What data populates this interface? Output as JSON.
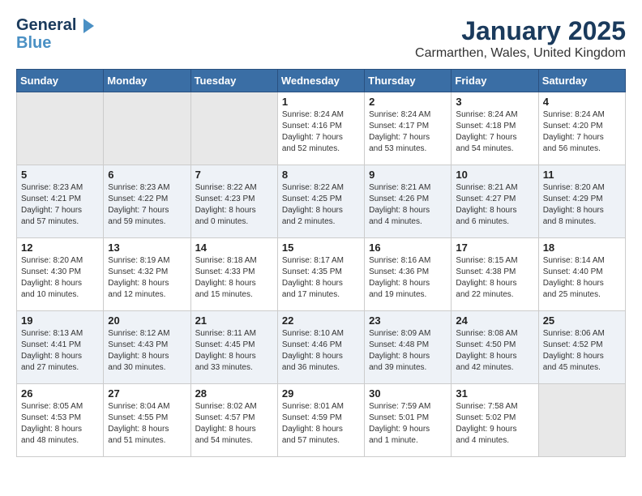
{
  "header": {
    "logo_line1": "General",
    "logo_line2": "Blue",
    "month": "January 2025",
    "location": "Carmarthen, Wales, United Kingdom"
  },
  "weekdays": [
    "Sunday",
    "Monday",
    "Tuesday",
    "Wednesday",
    "Thursday",
    "Friday",
    "Saturday"
  ],
  "weeks": [
    [
      {
        "day": "",
        "info": ""
      },
      {
        "day": "",
        "info": ""
      },
      {
        "day": "",
        "info": ""
      },
      {
        "day": "1",
        "info": "Sunrise: 8:24 AM\nSunset: 4:16 PM\nDaylight: 7 hours\nand 52 minutes."
      },
      {
        "day": "2",
        "info": "Sunrise: 8:24 AM\nSunset: 4:17 PM\nDaylight: 7 hours\nand 53 minutes."
      },
      {
        "day": "3",
        "info": "Sunrise: 8:24 AM\nSunset: 4:18 PM\nDaylight: 7 hours\nand 54 minutes."
      },
      {
        "day": "4",
        "info": "Sunrise: 8:24 AM\nSunset: 4:20 PM\nDaylight: 7 hours\nand 56 minutes."
      }
    ],
    [
      {
        "day": "5",
        "info": "Sunrise: 8:23 AM\nSunset: 4:21 PM\nDaylight: 7 hours\nand 57 minutes."
      },
      {
        "day": "6",
        "info": "Sunrise: 8:23 AM\nSunset: 4:22 PM\nDaylight: 7 hours\nand 59 minutes."
      },
      {
        "day": "7",
        "info": "Sunrise: 8:22 AM\nSunset: 4:23 PM\nDaylight: 8 hours\nand 0 minutes."
      },
      {
        "day": "8",
        "info": "Sunrise: 8:22 AM\nSunset: 4:25 PM\nDaylight: 8 hours\nand 2 minutes."
      },
      {
        "day": "9",
        "info": "Sunrise: 8:21 AM\nSunset: 4:26 PM\nDaylight: 8 hours\nand 4 minutes."
      },
      {
        "day": "10",
        "info": "Sunrise: 8:21 AM\nSunset: 4:27 PM\nDaylight: 8 hours\nand 6 minutes."
      },
      {
        "day": "11",
        "info": "Sunrise: 8:20 AM\nSunset: 4:29 PM\nDaylight: 8 hours\nand 8 minutes."
      }
    ],
    [
      {
        "day": "12",
        "info": "Sunrise: 8:20 AM\nSunset: 4:30 PM\nDaylight: 8 hours\nand 10 minutes."
      },
      {
        "day": "13",
        "info": "Sunrise: 8:19 AM\nSunset: 4:32 PM\nDaylight: 8 hours\nand 12 minutes."
      },
      {
        "day": "14",
        "info": "Sunrise: 8:18 AM\nSunset: 4:33 PM\nDaylight: 8 hours\nand 15 minutes."
      },
      {
        "day": "15",
        "info": "Sunrise: 8:17 AM\nSunset: 4:35 PM\nDaylight: 8 hours\nand 17 minutes."
      },
      {
        "day": "16",
        "info": "Sunrise: 8:16 AM\nSunset: 4:36 PM\nDaylight: 8 hours\nand 19 minutes."
      },
      {
        "day": "17",
        "info": "Sunrise: 8:15 AM\nSunset: 4:38 PM\nDaylight: 8 hours\nand 22 minutes."
      },
      {
        "day": "18",
        "info": "Sunrise: 8:14 AM\nSunset: 4:40 PM\nDaylight: 8 hours\nand 25 minutes."
      }
    ],
    [
      {
        "day": "19",
        "info": "Sunrise: 8:13 AM\nSunset: 4:41 PM\nDaylight: 8 hours\nand 27 minutes."
      },
      {
        "day": "20",
        "info": "Sunrise: 8:12 AM\nSunset: 4:43 PM\nDaylight: 8 hours\nand 30 minutes."
      },
      {
        "day": "21",
        "info": "Sunrise: 8:11 AM\nSunset: 4:45 PM\nDaylight: 8 hours\nand 33 minutes."
      },
      {
        "day": "22",
        "info": "Sunrise: 8:10 AM\nSunset: 4:46 PM\nDaylight: 8 hours\nand 36 minutes."
      },
      {
        "day": "23",
        "info": "Sunrise: 8:09 AM\nSunset: 4:48 PM\nDaylight: 8 hours\nand 39 minutes."
      },
      {
        "day": "24",
        "info": "Sunrise: 8:08 AM\nSunset: 4:50 PM\nDaylight: 8 hours\nand 42 minutes."
      },
      {
        "day": "25",
        "info": "Sunrise: 8:06 AM\nSunset: 4:52 PM\nDaylight: 8 hours\nand 45 minutes."
      }
    ],
    [
      {
        "day": "26",
        "info": "Sunrise: 8:05 AM\nSunset: 4:53 PM\nDaylight: 8 hours\nand 48 minutes."
      },
      {
        "day": "27",
        "info": "Sunrise: 8:04 AM\nSunset: 4:55 PM\nDaylight: 8 hours\nand 51 minutes."
      },
      {
        "day": "28",
        "info": "Sunrise: 8:02 AM\nSunset: 4:57 PM\nDaylight: 8 hours\nand 54 minutes."
      },
      {
        "day": "29",
        "info": "Sunrise: 8:01 AM\nSunset: 4:59 PM\nDaylight: 8 hours\nand 57 minutes."
      },
      {
        "day": "30",
        "info": "Sunrise: 7:59 AM\nSunset: 5:01 PM\nDaylight: 9 hours\nand 1 minute."
      },
      {
        "day": "31",
        "info": "Sunrise: 7:58 AM\nSunset: 5:02 PM\nDaylight: 9 hours\nand 4 minutes."
      },
      {
        "day": "",
        "info": ""
      }
    ]
  ]
}
